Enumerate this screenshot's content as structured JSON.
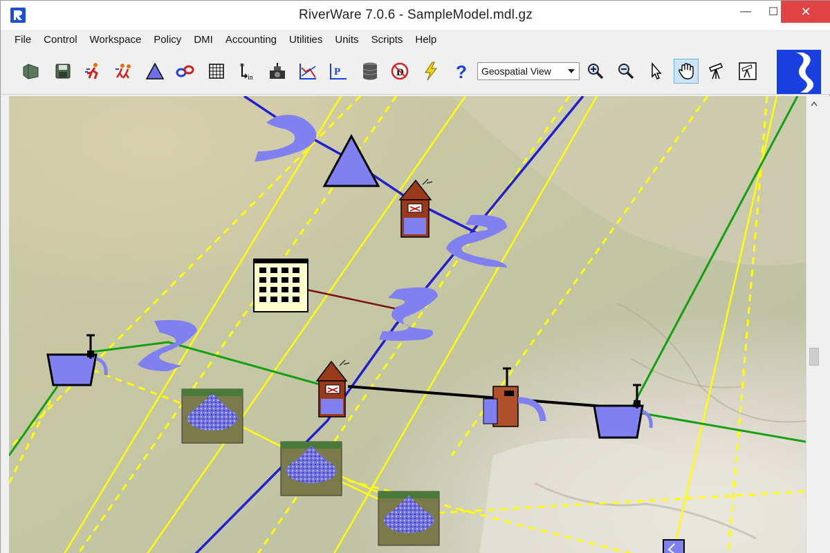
{
  "window": {
    "title": "RiverWare 7.0.6 - SampleModel.mdl.gz",
    "minimize_glyph": "—",
    "maximize_glyph": "☐",
    "close_glyph": "✕"
  },
  "menu": {
    "items": [
      "File",
      "Control",
      "Workspace",
      "Policy",
      "DMI",
      "Accounting",
      "Utilities",
      "Units",
      "Scripts",
      "Help"
    ]
  },
  "toolbar": {
    "buttons": [
      {
        "name": "open-model-icon"
      },
      {
        "name": "save-model-icon"
      },
      {
        "name": "run-icon"
      },
      {
        "name": "run-multiple-icon"
      },
      {
        "name": "reservoir-object-icon"
      },
      {
        "name": "link-icon"
      },
      {
        "name": "data-table-icon"
      },
      {
        "name": "slot-input-icon"
      },
      {
        "name": "dmi-icon"
      },
      {
        "name": "plot-icon"
      },
      {
        "name": "policy-editor-icon"
      },
      {
        "name": "database-icon"
      },
      {
        "name": "diagnostics-icon"
      },
      {
        "name": "lightning-icon"
      },
      {
        "name": "help-icon"
      }
    ],
    "view_select": {
      "value": "Geospatial View"
    },
    "tools": [
      {
        "name": "zoom-in-icon"
      },
      {
        "name": "zoom-out-icon"
      },
      {
        "name": "pointer-icon"
      },
      {
        "name": "pan-hand-icon",
        "active": true
      },
      {
        "name": "telescope-icon"
      },
      {
        "name": "easel-telescope-icon"
      }
    ]
  },
  "colors": {
    "river_blue": "#1f1fd0",
    "yellow_line": "#ffff00",
    "green_line": "#10a010",
    "dark_red_line": "#7a1010",
    "object_fill": "#8080f0",
    "accent": "#1a3fe0"
  },
  "map_objects": [
    {
      "type": "reach",
      "name": "reach-icon"
    },
    {
      "type": "storage-reservoir",
      "name": "reservoir-triangle-icon"
    },
    {
      "type": "power-reservoir",
      "name": "power-reservoir-icon"
    },
    {
      "type": "data-object",
      "name": "data-object-icon"
    },
    {
      "type": "water-user",
      "name": "water-user-icon"
    },
    {
      "type": "groundwater",
      "name": "groundwater-storage-icon"
    },
    {
      "type": "diversion",
      "name": "diversion-icon"
    }
  ]
}
